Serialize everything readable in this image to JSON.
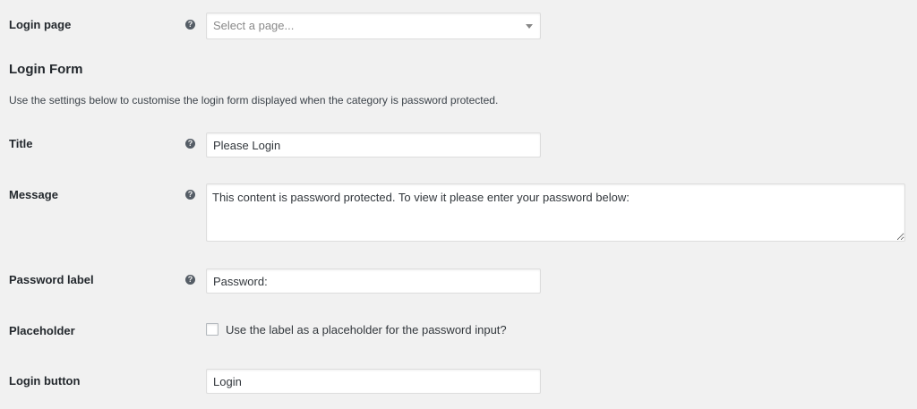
{
  "help_glyph": "?",
  "login_page": {
    "label": "Login page",
    "placeholder": "Select a page..."
  },
  "login_form": {
    "heading": "Login Form",
    "description": "Use the settings below to customise the login form displayed when the category is password protected."
  },
  "title_field": {
    "label": "Title",
    "value": "Please Login"
  },
  "message_field": {
    "label": "Message",
    "value": "This content is password protected. To view it please enter your password below:"
  },
  "password_label_field": {
    "label": "Password label",
    "value": "Password:"
  },
  "placeholder_field": {
    "label": "Placeholder",
    "checkbox_label": "Use the label as a placeholder for the password input?",
    "checked": false
  },
  "login_button_field": {
    "label": "Login button",
    "value": "Login"
  },
  "colors": {
    "background": "#f1f1f1",
    "text": "#23282d",
    "border": "#dddddd",
    "help_icon": "#555d66"
  }
}
